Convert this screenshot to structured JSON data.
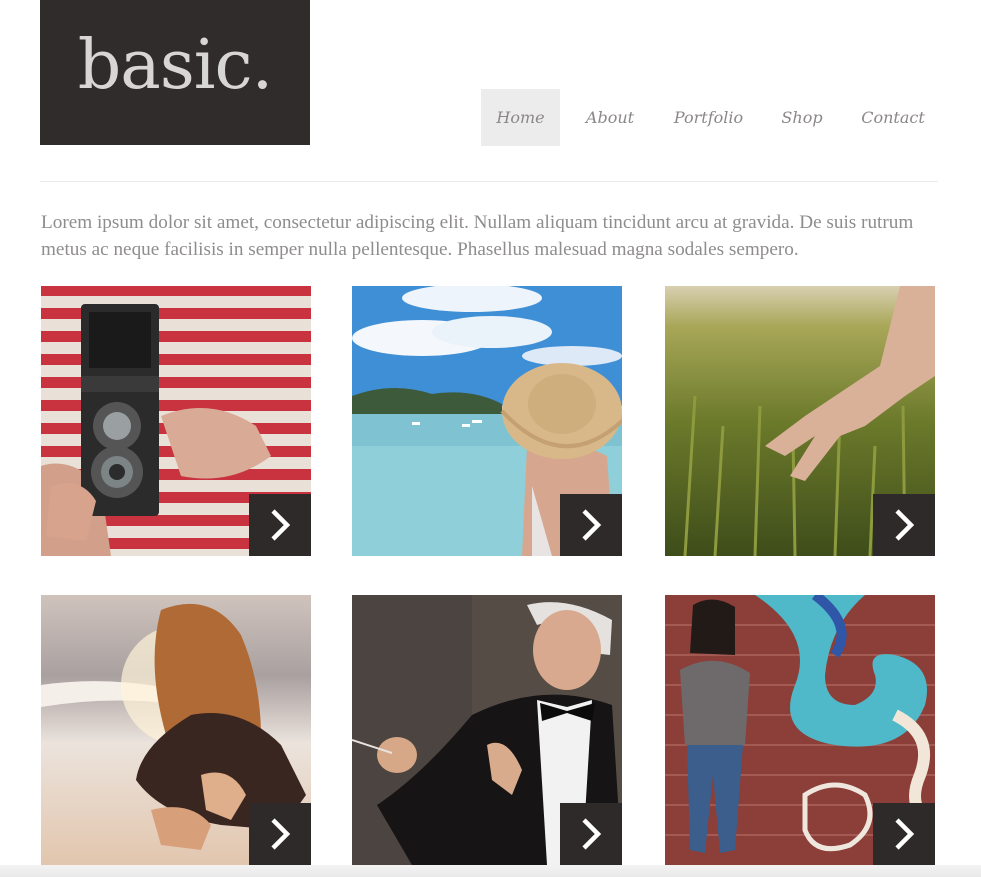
{
  "header": {
    "logo_text": "basic."
  },
  "nav": {
    "items": [
      "Home",
      "About",
      "Portfolio",
      "Shop",
      "Contact"
    ],
    "active": "Home"
  },
  "intro": {
    "text": "Lorem ipsum dolor sit amet, consectetur adipiscing elit. Nullam aliquam tincidunt arcu at gravida. De suis rutrum metus ac neque facilisis in semper nulla pellentesque. Phasellus malesuad magna sodales sempero."
  },
  "gallery": {
    "tiles": [
      {
        "subject": "camera-photo"
      },
      {
        "subject": "beach-hat-photo"
      },
      {
        "subject": "wheat-field-photo"
      },
      {
        "subject": "girl-on-beach-photo"
      },
      {
        "subject": "conductor-photo"
      },
      {
        "subject": "graffiti-wall-photo"
      }
    ],
    "arrow_icon": "chevron-right-icon"
  },
  "colors": {
    "logo_bg": "#312c2c",
    "logo_text": "#d8d6d4",
    "nav_text": "#8c8787",
    "nav_active_bg": "#ececec",
    "arrow_bg": "#2f2a2a",
    "body_text": "#8f8c8c"
  }
}
